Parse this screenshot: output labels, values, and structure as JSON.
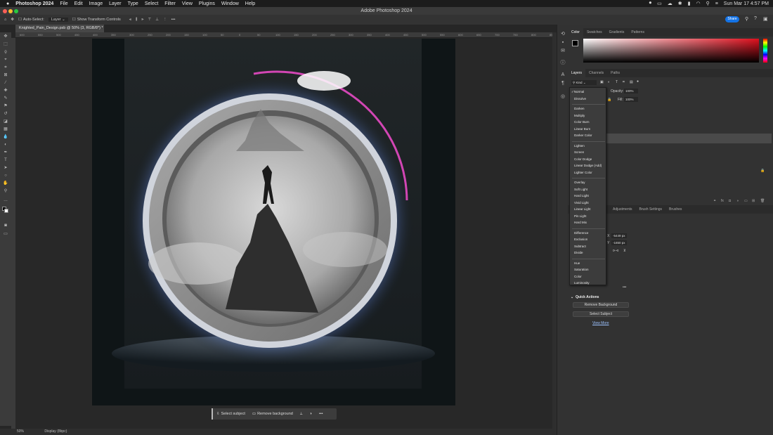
{
  "menubar": {
    "apple": "",
    "app": "Photoshop 2024",
    "items": [
      "File",
      "Edit",
      "Image",
      "Layer",
      "Type",
      "Select",
      "Filter",
      "View",
      "Plugins",
      "Window",
      "Help"
    ],
    "datetime": "Sun Mar 17  4:57 PM"
  },
  "window": {
    "title": "Adobe Photoshop 2024"
  },
  "options": {
    "auto_select": "Auto-Select:",
    "layer_value": "Layer",
    "show_transform": "Show Transform Controls",
    "share": "Share"
  },
  "document": {
    "tab": "Knighted_Pain_Design.psb @ 50% (3, RGB/8*) *",
    "zoom": "50%",
    "status": "Display (8bpc)"
  },
  "ruler_ticks": [
    "600",
    "550",
    "500",
    "450",
    "400",
    "350",
    "300",
    "250",
    "200",
    "150",
    "100",
    "50",
    "0",
    "50",
    "100",
    "150",
    "200",
    "250",
    "300",
    "350",
    "400",
    "450",
    "500",
    "550",
    "600",
    "650",
    "700",
    "750",
    "800",
    "850"
  ],
  "contextual_bar": {
    "select_subject": "Select subject",
    "remove_background": "Remove background"
  },
  "panels": {
    "color_tabs": [
      "Color",
      "Swatches",
      "Gradients",
      "Patterns"
    ],
    "layers_tabs": [
      "Layers",
      "Channels",
      "Paths"
    ],
    "kind_label": "Kind",
    "opacity_label": "Opacity:",
    "opacity_value": "100%",
    "fill_label": "Fill:",
    "fill_value": "100%",
    "props_tabs": [
      "Adjustments",
      "Brush Settings",
      "Brushes"
    ],
    "x_label": "X",
    "x_value": "-5449 px",
    "y_label": "Y",
    "y_value": "-1650 px",
    "quick_actions_title": "Quick Actions",
    "remove_background_btn": "Remove Background",
    "select_subject_btn": "Select Subject",
    "view_more": "View More"
  },
  "blend_modes": {
    "selected": "Normal",
    "groups": [
      [
        "Normal",
        "Dissolve"
      ],
      [
        "Darken",
        "Multiply",
        "Color Burn",
        "Linear Burn",
        "Darker Color"
      ],
      [
        "Lighten",
        "Screen",
        "Color Dodge",
        "Linear Dodge (Add)",
        "Lighter Color"
      ],
      [
        "Overlay",
        "Soft Light",
        "Hard Light",
        "Vivid Light",
        "Linear Light",
        "Pin Light",
        "Hard Mix"
      ],
      [
        "Difference",
        "Exclusion",
        "Subtract",
        "Divide"
      ],
      [
        "Hue",
        "Saturation",
        "Color",
        "Luminosity"
      ]
    ]
  },
  "colors": {
    "accent": "#1473e6",
    "glow": "#aac4ff",
    "magenta_rim": "#ff4fd8"
  }
}
